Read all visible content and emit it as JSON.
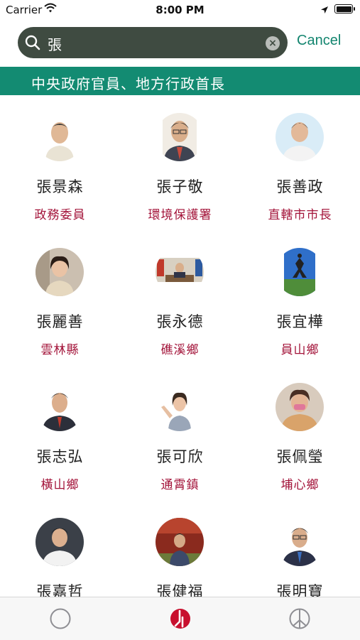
{
  "status_bar": {
    "carrier": "Carrier",
    "time": "8:00 PM"
  },
  "search": {
    "value": "張",
    "cancel_label": "Cancel"
  },
  "section": {
    "title": "中央政府官員、地方行政首長"
  },
  "people": [
    {
      "name": "張景森",
      "role": "政務委員"
    },
    {
      "name": "張子敬",
      "role": "環境保護署"
    },
    {
      "name": "張善政",
      "role": "直轄市市長"
    },
    {
      "name": "張麗善",
      "role": "雲林縣"
    },
    {
      "name": "張永德",
      "role": "礁溪鄉"
    },
    {
      "name": "張宜樺",
      "role": "員山鄉"
    },
    {
      "name": "張志弘",
      "role": "橫山鄉"
    },
    {
      "name": "張可欣",
      "role": "通霄鎮"
    },
    {
      "name": "張佩瑩",
      "role": "埔心鄉"
    },
    {
      "name": "張嘉哲",
      "role": ""
    },
    {
      "name": "張健福",
      "role": ""
    },
    {
      "name": "張明寶",
      "role": ""
    }
  ],
  "tabs": [
    {
      "icon": "circle-icon"
    },
    {
      "icon": "party-logo-icon"
    },
    {
      "icon": "peace-icon"
    }
  ],
  "colors": {
    "accent": "#138b72",
    "role_text": "#a3143a",
    "search_bg": "#3f4b41"
  }
}
